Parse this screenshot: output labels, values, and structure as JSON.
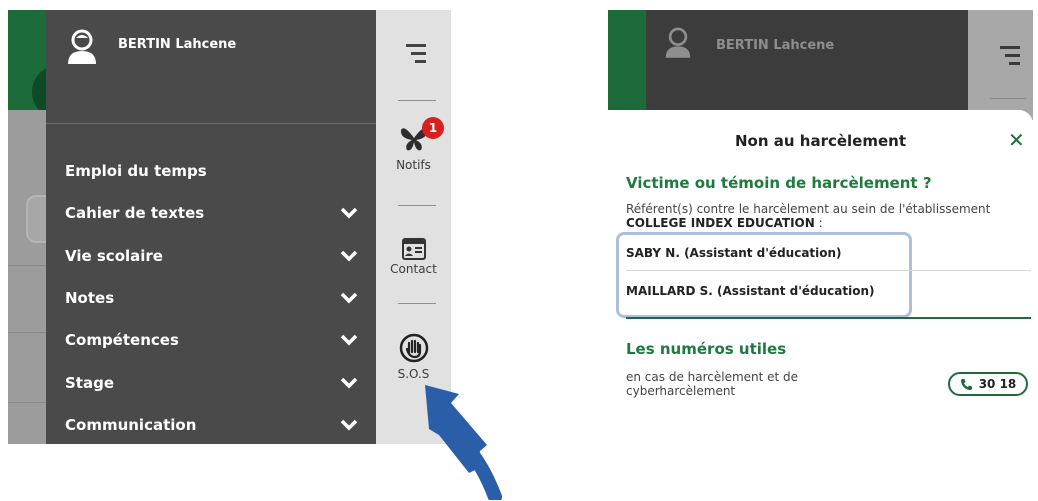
{
  "left": {
    "user_name": "BERTIN Lahcene",
    "menu": [
      {
        "label": "Emploi du temps",
        "has_chevron": false
      },
      {
        "label": "Cahier de textes",
        "has_chevron": true
      },
      {
        "label": "Vie scolaire",
        "has_chevron": true
      },
      {
        "label": "Notes",
        "has_chevron": true
      },
      {
        "label": "Compétences",
        "has_chevron": true
      },
      {
        "label": "Stage",
        "has_chevron": true
      },
      {
        "label": "Communication",
        "has_chevron": true
      }
    ],
    "sidebar": {
      "notifs_label": "Notifs",
      "notifs_badge": "1",
      "contact_label": "Contact",
      "sos_label": "S.O.S"
    }
  },
  "right": {
    "user_name": "BERTIN Lahcene",
    "dialog": {
      "title": "Non au harcèlement",
      "close_symbol": "✕",
      "heading": "Victime ou témoin de harcèlement ?",
      "intro_prefix": "Référent(s) contre le harcèlement au sein de l'établissement",
      "intro_school": "COLLEGE INDEX EDUCATION",
      "intro_suffix": " :",
      "referents": [
        "SABY N. (Assistant d'éducation)",
        "MAILLARD S. (Assistant d'éducation)"
      ],
      "useful_heading": "Les numéros utiles",
      "useful_text": "en cas de harcèlement et de cyberharcèlement",
      "phone_number": "30 18"
    }
  },
  "colors": {
    "brand_green": "#1d6b3a",
    "menu_dark": "#4a4a4a",
    "badge_red": "#d8201f",
    "highlight_blue": "#aebfdd",
    "arrow_blue": "#2b5ea8"
  }
}
